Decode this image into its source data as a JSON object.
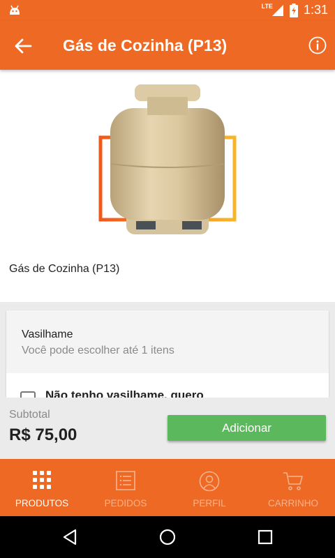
{
  "status_bar": {
    "network": "LTE",
    "time": "1:31"
  },
  "app_bar": {
    "title": "Gás de Cozinha (P13)"
  },
  "product": {
    "name": "Gás de Cozinha (P13)"
  },
  "options_group": {
    "title": "Vasilhame",
    "subtitle": "Você pode escolher até 1 itens",
    "first_option": "Não tenho vasilhame, quero"
  },
  "footer": {
    "subtotal_label": "Subtotal",
    "subtotal_value": "R$ 75,00",
    "add_label": "Adicionar"
  },
  "bottom_nav": {
    "items": [
      {
        "label": "PRODUTOS",
        "icon": "grid-icon",
        "active": true
      },
      {
        "label": "PEDIDOS",
        "icon": "list-icon",
        "active": false
      },
      {
        "label": "PERFIL",
        "icon": "user-icon",
        "active": false
      },
      {
        "label": "CARRINHO",
        "icon": "cart-icon",
        "active": false
      }
    ]
  },
  "colors": {
    "brand": "#ee6a24",
    "button": "#5cb85c"
  }
}
